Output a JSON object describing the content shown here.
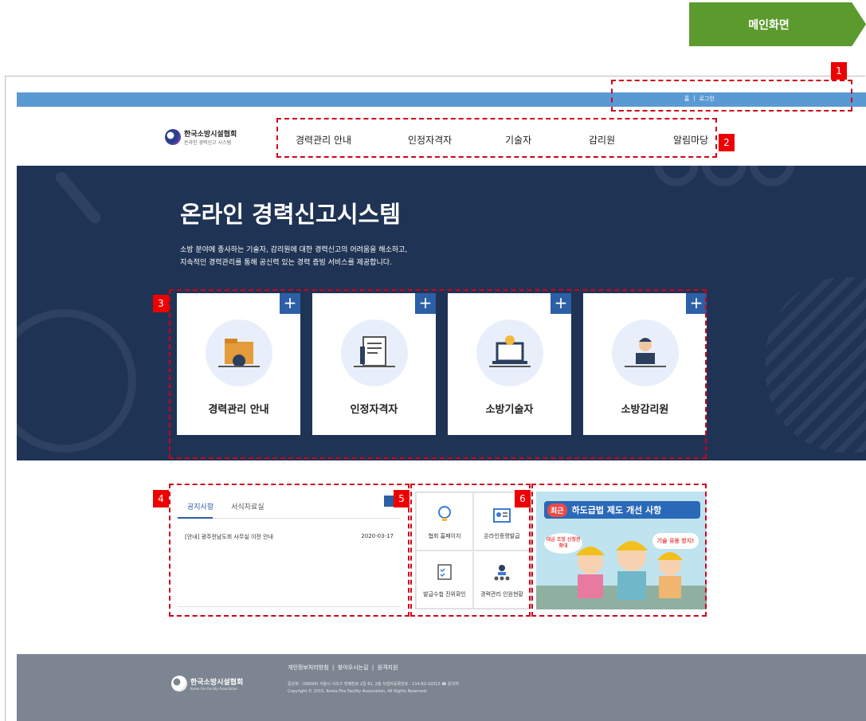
{
  "tag": {
    "label": "메인화면"
  },
  "topbar": {
    "home": "홈",
    "sep": "|",
    "login": "로그인"
  },
  "logo": {
    "name": "한국소방시설협회",
    "sub": "온라인 경력신고 시스템"
  },
  "nav": {
    "items": [
      "경력관리 안내",
      "인정자격자",
      "기술자",
      "감리원",
      "알림마당"
    ]
  },
  "hero": {
    "title": "온라인 경력신고시스템",
    "desc1": "소방 분야에 종사하는 기술자, 감리원에 대한 경력신고의 어려움을 해소하고,",
    "desc2": "지속적인 경력관리를 통해 공신력 있는 경력 증빙 서비스를 제공합니다."
  },
  "cards": [
    {
      "label": "경력관리 안내",
      "plus": "+"
    },
    {
      "label": "인정자격자",
      "plus": "+"
    },
    {
      "label": "소방기술자",
      "plus": "+"
    },
    {
      "label": "소방감리원",
      "plus": "+"
    }
  ],
  "notice": {
    "tab1": "공지사항",
    "tab2": "서식자료실",
    "row_title": "[안내] 광주전남도회 사무실 이전 안내",
    "row_date": "2020-03-17"
  },
  "quick": [
    {
      "label": "협회 홈페이지"
    },
    {
      "label": "온라인증명발급"
    },
    {
      "label": "발급수첩 진위확인"
    },
    {
      "label": "경력관리 인원현황"
    }
  ],
  "banner": {
    "badge": "최근",
    "title": "하도급법 제도 개선 사항",
    "left": "대금 조정 신청권 확대",
    "right": "기술 유용 방지!"
  },
  "footer": {
    "logo": "한국소방시설협회",
    "logo_sub": "Korea Fire Facility Association",
    "links": "개인정보처리방침  |  찾아오시는길  |  원격지원",
    "address": "중앙회 : (06694) 서울시 서초구 방배천로 2길 61, 2층 사업자등록번호 : 114-82-10313 ☎ 문의처",
    "copyright": "Copyright © 2015, Korea Fire Facility Association, All Rights Reserved."
  },
  "markers": [
    "1",
    "2",
    "3",
    "4",
    "5",
    "6"
  ],
  "colors": {
    "tag": "#5b9a2c",
    "topbar": "#5a9ad3",
    "hero": "#1f3354",
    "accent": "#2c5fa5",
    "marker": "#e00000",
    "footer": "#7c8591"
  }
}
